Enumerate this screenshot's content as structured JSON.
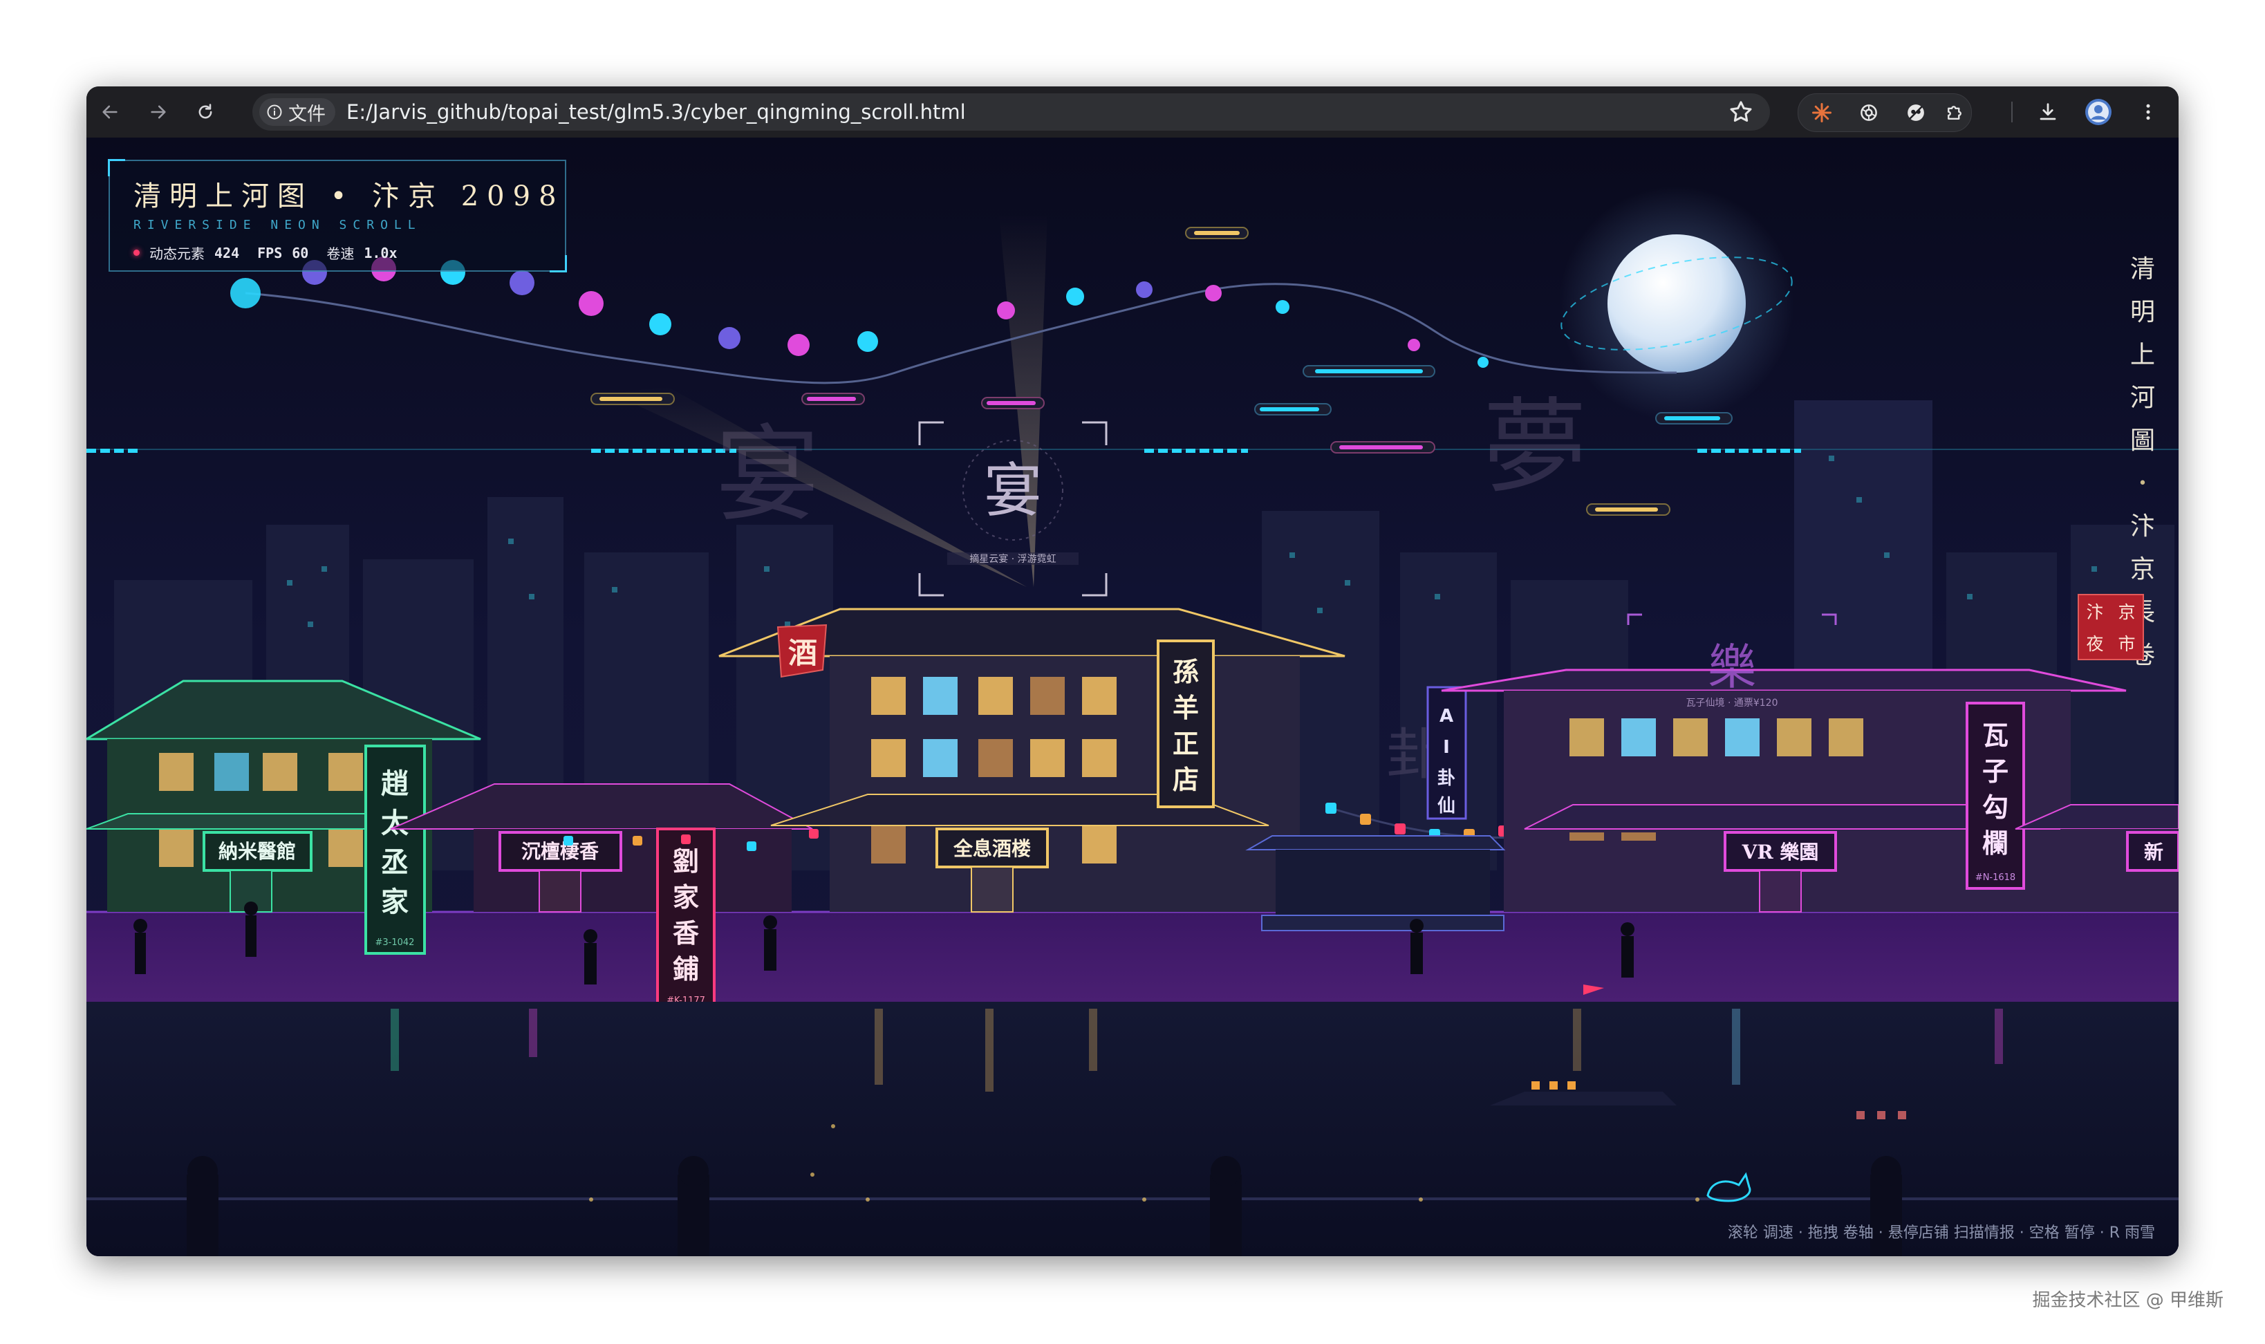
{
  "browser": {
    "info_chip_label": "文件",
    "url": "E:/Jarvis_github/topai_test/glm5.3/cyber_qingming_scroll.html",
    "icons": [
      "back-icon",
      "forward-icon",
      "reload-icon",
      "info-icon",
      "star-icon",
      "spark-extension-icon",
      "openai-extension-icon",
      "ghost-extension-icon",
      "puzzle-icon",
      "download-icon",
      "avatar",
      "more-icon"
    ]
  },
  "hud": {
    "title": "清明上河图 • 汴京 2098",
    "subtitle": "RIVERSIDE NEON SCROLL",
    "elements_label": "动态元素",
    "elements_value": "424",
    "fps_label": "FPS",
    "fps_value": "60",
    "speed_label": "卷速",
    "speed_value": "1.0x"
  },
  "vertical_title": [
    "清",
    "明",
    "上",
    "河",
    "圖",
    "•",
    "汴",
    "京",
    "長",
    "卷"
  ],
  "seal": [
    "汴",
    "京",
    "夜",
    "市"
  ],
  "hint": "滚轮 调速 · 拖拽 卷轴 · 悬停店铺 扫描情报 · 空格 暂停 · R 雨雪",
  "watermark": "掘金技术社区 @ 甲维斯",
  "scene": {
    "tower_sign": "宴",
    "tower_caption": "摘星云宴 · 浮游霓虹",
    "ghost_chars": [
      "宴",
      "夢",
      "卦",
      "樂"
    ],
    "wine_flag": "酒",
    "main_plaque": "全息酒楼",
    "main_vertical": "孫羊正店",
    "left_plaque": "納米醫館",
    "zhao_vertical": "趙太丞家",
    "zhao_code": "#3-1042",
    "tea_plaque": "沉檀棲香",
    "liu_vertical": "劉家香鋪",
    "liu_code": "#K-1177",
    "ai_vertical": "AI卦仙",
    "right_sign": "樂",
    "right_caption": "瓦子仙境 · 通票¥120",
    "vr_plaque": "VR 樂園",
    "wazi_vertical": "瓦子勾欄",
    "wazi_code": "#N-1618",
    "edge_plaque": "新",
    "colors": {
      "cyan": "#2ad8ff",
      "magenta": "#e04bdc",
      "gold": "#f0c766",
      "purple": "#5a1f7a",
      "green": "#3be2a4",
      "red": "#c42b3a"
    }
  }
}
